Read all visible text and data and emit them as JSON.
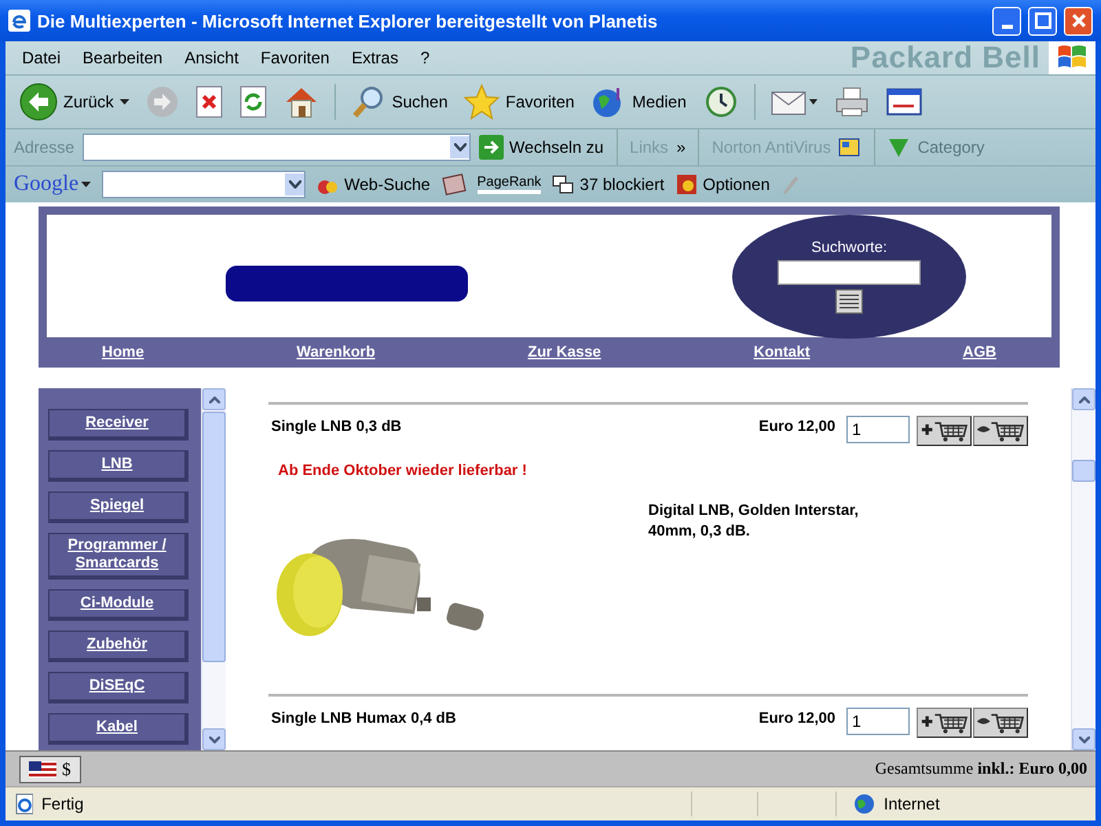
{
  "window": {
    "title": "Die Multiexperten - Microsoft Internet Explorer bereitgestellt von Planetis"
  },
  "menu": [
    "Datei",
    "Bearbeiten",
    "Ansicht",
    "Favoriten",
    "Extras",
    "?"
  ],
  "brand": "Packard Bell",
  "toolbar": [
    {
      "kind": "back",
      "label": "Zurück"
    },
    {
      "kind": "forward"
    },
    {
      "kind": "stop"
    },
    {
      "kind": "refresh"
    },
    {
      "kind": "home"
    },
    {
      "kind": "search",
      "label": "Suchen"
    },
    {
      "kind": "favorites",
      "label": "Favoriten"
    },
    {
      "kind": "media",
      "label": "Medien"
    },
    {
      "kind": "history"
    },
    {
      "kind": "mail"
    },
    {
      "kind": "print"
    },
    {
      "kind": "edit"
    }
  ],
  "address_bar": {
    "label": "Adresse",
    "go": "Wechseln zu",
    "links": "Links",
    "chevron": "»",
    "norton": "Norton AntiVirus",
    "category": "Category"
  },
  "google_bar": {
    "logo": "Google",
    "search": "Web-Suche",
    "pagerank": "PageRank",
    "blocked": "37 blockiert",
    "options": "Optionen"
  },
  "site": {
    "search_label": "Suchworte:",
    "nav": [
      "Home",
      "Warenkorb",
      "Zur Kasse",
      "Kontakt",
      "AGB"
    ],
    "categories": [
      "Receiver",
      "LNB",
      "Spiegel",
      "Programmer / Smartcards",
      "Ci-Module",
      "Zubehör",
      "DiSEqC",
      "Kabel"
    ],
    "products": [
      {
        "name": "Single LNB 0,3 dB",
        "price": "Euro 12,00",
        "quantity": "1",
        "notice": "Ab Ende Oktober wieder lieferbar !",
        "description": "Digital LNB, Golden Interstar, 40mm, 0,3 dB."
      },
      {
        "name": "Single LNB Humax 0,4 dB",
        "price": "Euro 12,00",
        "quantity": "1"
      }
    ],
    "currency": "$",
    "total": "Gesamtsumme **inkl.: Euro 0,00**"
  },
  "status_bar": {
    "text": "Fertig",
    "zone": "Internet"
  }
}
